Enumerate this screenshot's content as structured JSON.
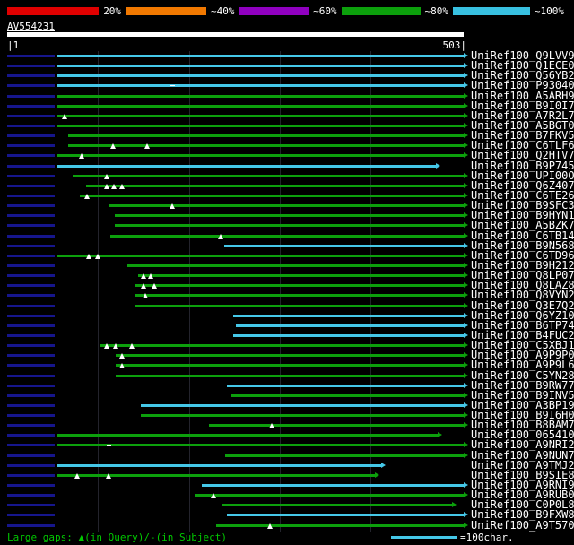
{
  "scale_bar": {
    "segments": [
      {
        "label": "20%",
        "color": "#e00000"
      },
      {
        "label": "~40%",
        "color": "#f07800"
      },
      {
        "label": "~60%",
        "color": "#9000c0"
      },
      {
        "label": "~80%",
        "color": "#0ca00c"
      },
      {
        "label": "~100%",
        "color": "#38c0e0"
      }
    ]
  },
  "query": {
    "name": "AV554231",
    "start_label": "|1",
    "end_label": "503|"
  },
  "legend": {
    "gaps_text": "Large gaps: ▲(in Query)/-(in Subject)",
    "unit_text": "=100char.",
    "unit_chars": 100
  },
  "colors": {
    "cyan": "#45c8e8",
    "green": "#0ca00c",
    "navy": "#16168c",
    "white": "#ffffff",
    "legend_text": "#00c800"
  },
  "chart_data": {
    "type": "bar",
    "subtype": "blast-alignment-overview",
    "title": "AV554231",
    "xlabel": "query position (char)",
    "xlim": [
      1,
      503
    ],
    "grid": "faint vertical lines every 100 chars",
    "leading_segment": {
      "start": 0,
      "end": 52,
      "color": "navy"
    },
    "rows": [
      {
        "label": "UniRef100_Q9LVV9",
        "color": "cyan",
        "start": 54,
        "end": 503,
        "arrowhead": true
      },
      {
        "label": "UniRef100_Q1ECE0",
        "color": "cyan",
        "start": 54,
        "end": 503,
        "arrowhead": true
      },
      {
        "label": "UniRef100_Q56YB2",
        "color": "cyan",
        "start": 54,
        "end": 503,
        "arrowhead": true
      },
      {
        "label": "UniRef100_P93040",
        "color": "cyan",
        "start": 54,
        "end": 503,
        "arrowhead": true,
        "subject_gaps": [
          182
        ]
      },
      {
        "label": "UniRef100_A5ARH9",
        "color": "green",
        "start": 54,
        "end": 503,
        "arrowhead": true
      },
      {
        "label": "UniRef100_B9I0I7",
        "color": "green",
        "start": 54,
        "end": 503,
        "arrowhead": true
      },
      {
        "label": "UniRef100_A7R2L7",
        "color": "green",
        "start": 54,
        "end": 503,
        "arrowhead": true,
        "query_gaps": [
          63
        ]
      },
      {
        "label": "UniRef100_A5BGT0",
        "color": "green",
        "start": 54,
        "end": 503,
        "arrowhead": true
      },
      {
        "label": "UniRef100_B7FKV5",
        "color": "green",
        "start": 67,
        "end": 503,
        "arrowhead": true
      },
      {
        "label": "UniRef100_C6TLF6",
        "color": "green",
        "start": 67,
        "end": 503,
        "arrowhead": true,
        "query_gaps": [
          117,
          154
        ]
      },
      {
        "label": "UniRef100_Q2HTV7",
        "color": "green",
        "start": 54,
        "end": 503,
        "arrowhead": true,
        "query_gaps": [
          82
        ]
      },
      {
        "label": "UniRef100_B9P745",
        "color": "cyan",
        "start": 54,
        "end": 472,
        "arrowhead": true
      },
      {
        "label": "UniRef100_UPI00O..",
        "color": "green",
        "start": 72,
        "end": 503,
        "arrowhead": true,
        "query_gaps": [
          110
        ]
      },
      {
        "label": "UniRef100_Q6Z407",
        "color": "green",
        "start": 87,
        "end": 503,
        "arrowhead": true,
        "query_gaps": [
          110,
          118,
          126
        ]
      },
      {
        "label": "UniRef100_C6TE26",
        "color": "green",
        "start": 80,
        "end": 503,
        "arrowhead": true,
        "query_gaps": [
          88
        ]
      },
      {
        "label": "UniRef100_B9SFC3",
        "color": "green",
        "start": 112,
        "end": 503,
        "arrowhead": true,
        "query_gaps": [
          182
        ]
      },
      {
        "label": "UniRef100_B9HYN1",
        "color": "green",
        "start": 119,
        "end": 503,
        "arrowhead": true
      },
      {
        "label": "UniRef100_A5BZK7",
        "color": "green",
        "start": 119,
        "end": 503,
        "arrowhead": true
      },
      {
        "label": "UniRef100_C6TB14",
        "color": "green",
        "start": 114,
        "end": 503,
        "arrowhead": true,
        "query_gaps": [
          235
        ]
      },
      {
        "label": "UniRef100_B9N568",
        "color": "cyan",
        "start": 239,
        "end": 503,
        "arrowhead": true
      },
      {
        "label": "UniRef100_C6TD96",
        "color": "green",
        "start": 54,
        "end": 503,
        "arrowhead": true,
        "query_gaps": [
          90,
          100
        ]
      },
      {
        "label": "UniRef100_B9H212",
        "color": "green",
        "start": 132,
        "end": 503,
        "arrowhead": true
      },
      {
        "label": "UniRef100_Q8LP07",
        "color": "green",
        "start": 144,
        "end": 503,
        "arrowhead": true,
        "query_gaps": [
          150,
          158
        ]
      },
      {
        "label": "UniRef100_Q8LAZ8",
        "color": "green",
        "start": 140,
        "end": 503,
        "arrowhead": true,
        "query_gaps": [
          150,
          162
        ]
      },
      {
        "label": "UniRef100_Q8VYN2",
        "color": "green",
        "start": 140,
        "end": 503,
        "arrowhead": true,
        "query_gaps": [
          152
        ]
      },
      {
        "label": "UniRef100_Q3E7Q2",
        "color": "green",
        "start": 140,
        "end": 503,
        "arrowhead": true
      },
      {
        "label": "UniRef100_Q6YZ10",
        "color": "cyan",
        "start": 249,
        "end": 503,
        "arrowhead": true
      },
      {
        "label": "UniRef100_B6TP74",
        "color": "cyan",
        "start": 252,
        "end": 503,
        "arrowhead": true
      },
      {
        "label": "UniRef100_B4FUC2",
        "color": "cyan",
        "start": 249,
        "end": 503,
        "arrowhead": true
      },
      {
        "label": "UniRef100_C5XBJ1",
        "color": "green",
        "start": 102,
        "end": 503,
        "arrowhead": true,
        "query_gaps": [
          110,
          120,
          137
        ]
      },
      {
        "label": "UniRef100_A9P9P0",
        "color": "green",
        "start": 120,
        "end": 503,
        "arrowhead": true,
        "query_gaps": [
          126
        ]
      },
      {
        "label": "UniRef100_A9P9L6",
        "color": "green",
        "start": 120,
        "end": 503,
        "arrowhead": true,
        "query_gaps": [
          126
        ]
      },
      {
        "label": "UniRef100_C5YN28",
        "color": "green",
        "start": 120,
        "end": 503,
        "arrowhead": true
      },
      {
        "label": "UniRef100_B9RW77",
        "color": "cyan",
        "start": 242,
        "end": 503,
        "arrowhead": true
      },
      {
        "label": "UniRef100_B9INV5",
        "color": "green",
        "start": 247,
        "end": 503,
        "arrowhead": true
      },
      {
        "label": "UniRef100_A3BP19",
        "color": "cyan",
        "start": 147,
        "end": 503,
        "arrowhead": true
      },
      {
        "label": "UniRef100_B9I6H0",
        "color": "green",
        "start": 147,
        "end": 503,
        "arrowhead": true
      },
      {
        "label": "UniRef100_B8BAM7",
        "color": "green",
        "start": 222,
        "end": 503,
        "arrowhead": true,
        "query_gaps": [
          292
        ]
      },
      {
        "label": "UniRef100_065410",
        "color": "green",
        "start": 54,
        "end": 474,
        "arrowhead": true
      },
      {
        "label": "UniRef100_A9NRI2",
        "color": "green",
        "start": 54,
        "end": 503,
        "arrowhead": true,
        "subject_gaps": [
          112
        ]
      },
      {
        "label": "UniRef100_A9NUN7",
        "color": "green",
        "start": 240,
        "end": 503,
        "arrowhead": true
      },
      {
        "label": "UniRef100_A9TMJ2",
        "color": "cyan",
        "start": 54,
        "end": 412,
        "arrowhead": true
      },
      {
        "label": "UniRef100_B9SIE8",
        "color": "green",
        "start": 54,
        "end": 405,
        "arrowhead": true,
        "query_gaps": [
          77,
          112
        ]
      },
      {
        "label": "UniRef100_A9RNI9",
        "color": "cyan",
        "start": 214,
        "end": 503,
        "arrowhead": true
      },
      {
        "label": "UniRef100_A9RUB0",
        "color": "green",
        "start": 207,
        "end": 503,
        "arrowhead": true,
        "query_gaps": [
          227
        ]
      },
      {
        "label": "UniRef100_C0P0L8",
        "color": "green",
        "start": 237,
        "end": 490,
        "arrowhead": true
      },
      {
        "label": "UniRef100_B9FXW8",
        "color": "cyan",
        "start": 242,
        "end": 503,
        "arrowhead": true
      },
      {
        "label": "UniRef100_A9T570",
        "color": "green",
        "start": 230,
        "end": 503,
        "arrowhead": true,
        "query_gaps": [
          290
        ]
      }
    ]
  }
}
